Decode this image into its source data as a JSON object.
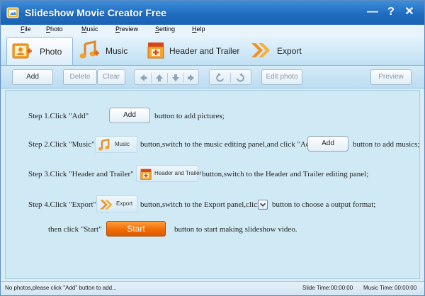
{
  "window": {
    "title": "Slideshow Movie Creator Free",
    "controls": {
      "minimize": "—",
      "help": "?",
      "close": "✕"
    }
  },
  "menu": [
    "File",
    "Photo",
    "Music",
    "Preview",
    "Setting",
    "Help"
  ],
  "tabs": [
    {
      "label": "Photo",
      "icon": "photo-icon",
      "active": true
    },
    {
      "label": "Music",
      "icon": "music-icon",
      "active": false
    },
    {
      "label": "Header and Trailer",
      "icon": "header-trailer-icon",
      "active": false
    },
    {
      "label": "Export",
      "icon": "export-icon",
      "active": false
    }
  ],
  "toolbar": {
    "add": "Add",
    "delete": "Delete",
    "clear": "Clear",
    "edit_photo": "Edit photo",
    "preview": "Preview"
  },
  "steps": {
    "s1_pre": "Step 1.Click \"Add\"",
    "s1_btn": "Add",
    "s1_post": "button to add pictures;",
    "s2_pre": "Step 2.Click \"Music\"",
    "s2_chip": "Music",
    "s2_mid": "button,switch to the music editing panel,and click \"Add\"",
    "s2_btn": "Add",
    "s2_post": "button to add musics;",
    "s3_pre": "Step 3.Click \"Header and Trailer\"",
    "s3_chip": "Header and Trailer",
    "s3_post": "button,switch to the Header and Trailer editing panel;",
    "s4_pre": "Step 4.Click \"Export\"",
    "s4_chip": "Export",
    "s4_mid": "button,switch to the Export panel,click",
    "s4_post": "button to choose a output format;",
    "s5_pre": "then click \"Start\"",
    "s5_btn": "Start",
    "s5_post": "button to start making slideshow video."
  },
  "status": {
    "message": "No photos,please click \"Add\" button to add...",
    "slide_time_label": "Slide Time:",
    "slide_time": "00:00:00",
    "music_time_label": "Music Time:",
    "music_time": "00:00:00"
  },
  "colors": {
    "accent": "#1f6cc0",
    "start": "#ee6a00",
    "panel": "#cfe9f5"
  }
}
